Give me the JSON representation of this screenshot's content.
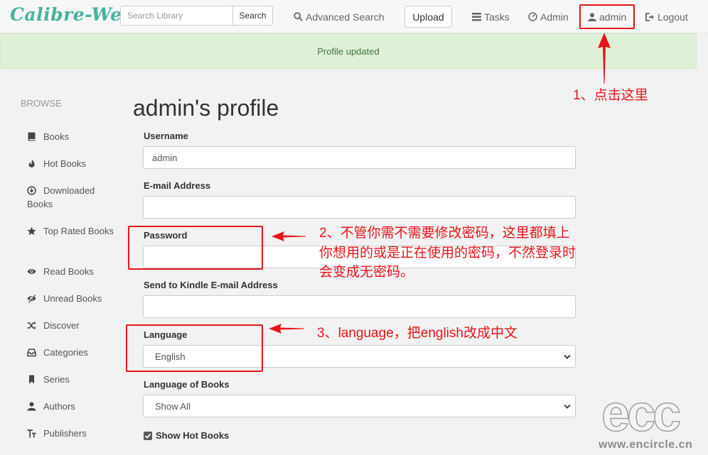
{
  "header": {
    "logo": "Calibre-Web",
    "search_placeholder": "Search Library",
    "search_button": "Search",
    "advanced_search": "Advanced Search",
    "upload": "Upload",
    "tasks": "Tasks",
    "admin_link": "Admin",
    "user_link": "admin",
    "logout": "Logout"
  },
  "alert": {
    "message": "Profile updated"
  },
  "sidebar": {
    "heading": "BROWSE",
    "items": [
      {
        "label": "Books",
        "icon": "book-icon"
      },
      {
        "label": "Hot Books",
        "icon": "fire-icon"
      },
      {
        "label": "Downloaded Books",
        "icon": "download-icon"
      },
      {
        "label": "Top Rated Books",
        "icon": "star-icon"
      },
      {
        "label": "Read Books",
        "icon": "eye-icon"
      },
      {
        "label": "Unread Books",
        "icon": "eye-slash-icon"
      },
      {
        "label": "Discover",
        "icon": "random-icon"
      },
      {
        "label": "Categories",
        "icon": "inbox-icon"
      },
      {
        "label": "Series",
        "icon": "bookmark-icon"
      },
      {
        "label": "Authors",
        "icon": "user-icon"
      },
      {
        "label": "Publishers",
        "icon": "text-size-icon"
      }
    ]
  },
  "profile": {
    "title": "admin's profile",
    "username_label": "Username",
    "username_value": "admin",
    "email_label": "E-mail Address",
    "email_value": "",
    "password_label": "Password",
    "password_value": "",
    "kindle_label": "Send to Kindle E-mail Address",
    "kindle_value": "",
    "language_label": "Language",
    "language_value": "English",
    "books_language_label": "Language of Books",
    "books_language_value": "Show All",
    "show_hot_books_label": "Show Hot Books",
    "show_hot_books_checked": true
  },
  "annotations": {
    "step1": "1、点击这里",
    "step2_line1": "2、不管你需不需要修改密码，这里都填上",
    "step2_line2": "你想用的或是正在使用的密码，不然登录时",
    "step2_line3": "会变成无密码。",
    "step3": "3、language，把english改成中文"
  },
  "watermark": {
    "letters": "ecc",
    "url": "www.encircle.cn"
  },
  "colors": {
    "brand": "#45b29d",
    "alert_bg": "#dff0d8",
    "alert_text": "#3c763d",
    "annotation_red": "#e8141a"
  }
}
